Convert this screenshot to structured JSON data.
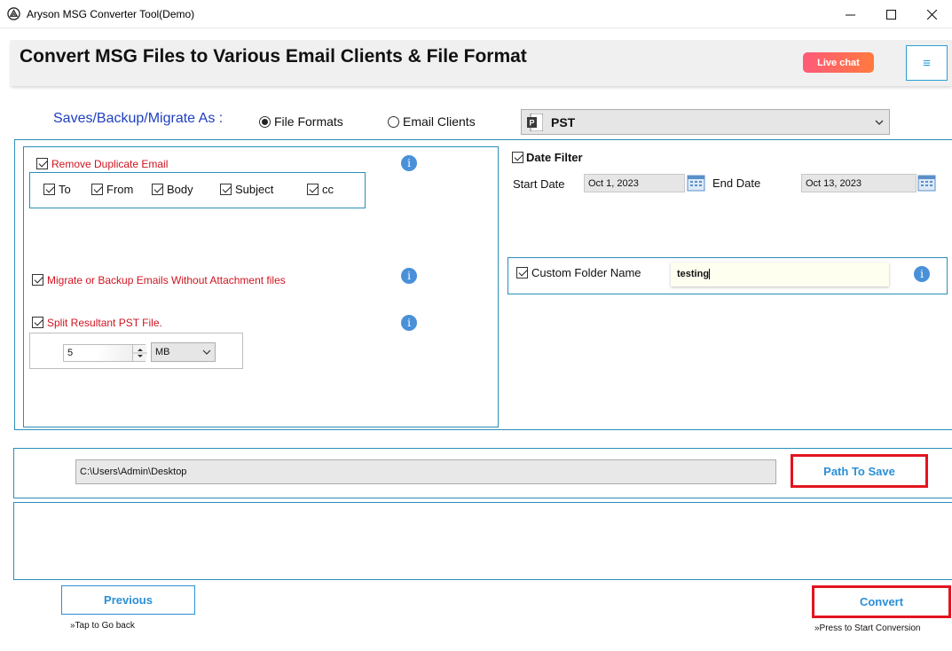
{
  "window": {
    "title": "Aryson MSG Converter Tool(Demo)",
    "minimize": "—",
    "maximize": "☐",
    "close": "✕"
  },
  "header": {
    "title": "Convert MSG Files to Various Email Clients & File Format",
    "live_chat": "Live chat",
    "menu_icon": "≡"
  },
  "save_as": {
    "label": "Saves/Backup/Migrate As :",
    "option_file_formats": "File Formats",
    "option_email_clients": "Email Clients",
    "selected_option": "File Formats",
    "format_value": "PST"
  },
  "left_panel": {
    "remove_duplicate": "Remove Duplicate Email",
    "dup_fields": [
      "To",
      "From",
      "Body",
      "Subject",
      "cc"
    ],
    "no_attachments": "Migrate or Backup Emails Without Attachment files",
    "split_pst": "Split Resultant PST File.",
    "split_size": "5",
    "split_unit": "MB"
  },
  "right_panel": {
    "date_filter": "Date Filter",
    "start_label": "Start Date",
    "start_value": "Oct 1, 2023",
    "end_label": "End Date",
    "end_value": "Oct 13, 2023",
    "custom_folder": "Custom Folder Name",
    "custom_folder_value": "testing"
  },
  "path": {
    "value": "C:\\Users\\Admin\\Desktop",
    "button": "Path To Save"
  },
  "footer": {
    "previous": "Previous",
    "previous_hint": "»Tap to Go back",
    "convert": "Convert",
    "convert_hint": "»Press to Start Conversion"
  },
  "colors": {
    "accent": "#2a8fd6",
    "highlight_red": "#e3141f",
    "label_blue": "#1f3fbf",
    "warning_red": "#d0141f",
    "info_blue": "#4a90d9"
  },
  "icons": [
    "app-logo-icon",
    "powerpoint-pst-icon",
    "dropdown-chevron-icon",
    "info-icon",
    "calendar-icon",
    "hamburger-menu-icon"
  ]
}
